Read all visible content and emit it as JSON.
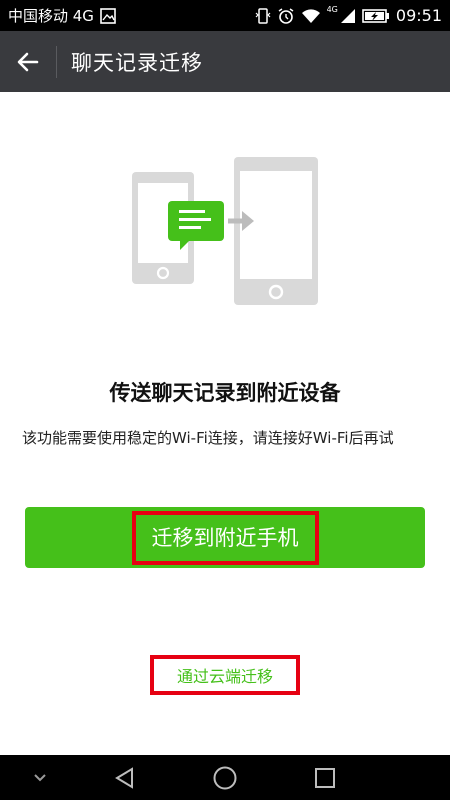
{
  "status_bar": {
    "carrier": "中国移动 4G",
    "network_small": "4G",
    "time": "09:51"
  },
  "header": {
    "title": "聊天记录迁移"
  },
  "main": {
    "title": "传送聊天记录到附近设备",
    "description": "该功能需要使用稳定的Wi-Fi连接，请连接好Wi-Fi后再试",
    "primary_button": "迁移到附近手机",
    "cloud_link": "通过云端迁移"
  },
  "colors": {
    "accent_green": "#45c01a",
    "header_bg": "#393a3e",
    "highlight_red": "#e60012"
  },
  "icons": {
    "back": "arrow-left-icon",
    "illustration": "phone-transfer-illustration",
    "nav_down": "chevron-down-icon",
    "nav_back": "triangle-back-icon",
    "nav_home": "circle-home-icon",
    "nav_recent": "square-recent-icon"
  }
}
